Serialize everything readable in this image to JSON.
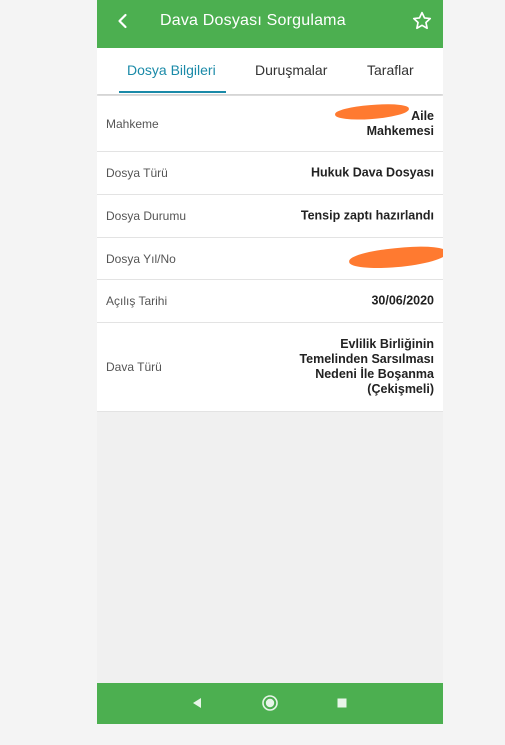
{
  "appbar": {
    "title": "Dava Dosyası Sorgulama",
    "back_icon": "chevron-left-icon",
    "favorite_icon": "star-outline-icon"
  },
  "tabs": [
    {
      "label": "Dosya Bilgileri",
      "active": true
    },
    {
      "label": "Duruşmalar",
      "active": false
    },
    {
      "label": "Taraflar",
      "active": false
    }
  ],
  "details": [
    {
      "label": "Mahkeme",
      "value": "Aile\nMahkemesi"
    },
    {
      "label": "Dosya Türü",
      "value": "Hukuk Dava Dosyası"
    },
    {
      "label": "Dosya Durumu",
      "value": "Tensip zaptı hazırlandı"
    },
    {
      "label": "Dosya Yıl/No",
      "value": ""
    },
    {
      "label": "Açılış Tarihi",
      "value": "30/06/2020"
    },
    {
      "label": "Dava Türü",
      "value": "Evlilik Birliğinin\nTemelinden Sarsılması\nNedeni İle Boşanma\n(Çekişmeli)"
    }
  ],
  "colors": {
    "primary": "#4caf50",
    "tab_active": "#1a8aa8",
    "redaction": "#ff7a30"
  },
  "navbar": {
    "icons": [
      "back-triangle-icon",
      "home-circle-icon",
      "recents-square-icon"
    ]
  }
}
